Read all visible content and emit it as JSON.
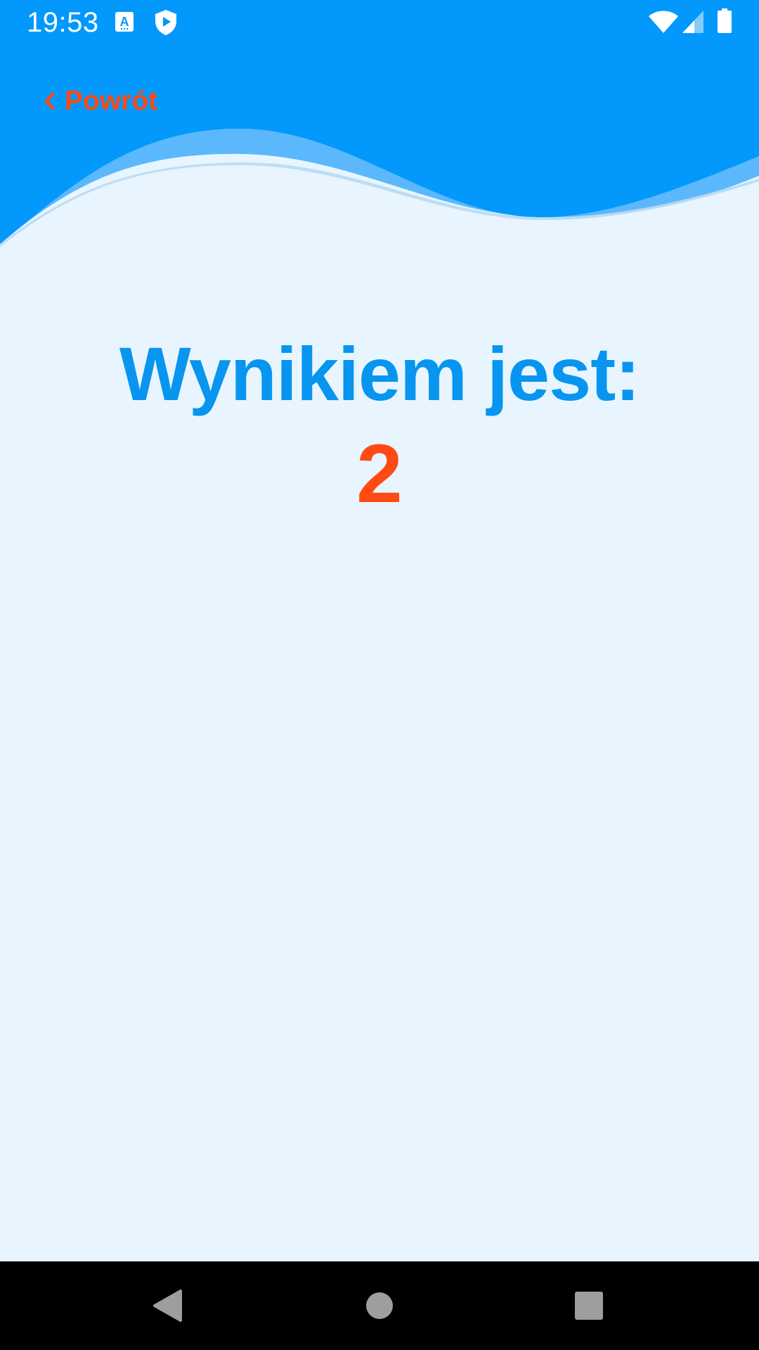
{
  "status_bar": {
    "time": "19:53",
    "icons": [
      "translate-icon",
      "shield-play-icon",
      "wifi-icon",
      "cellular-signal-icon",
      "battery-icon"
    ]
  },
  "header": {
    "back_label": "Powrót",
    "back_icon": "chevron-left-icon"
  },
  "main": {
    "result_title": "Wynikiem jest:",
    "result_value": "2"
  },
  "nav_bar": {
    "buttons": [
      "back-triangle-icon",
      "home-circle-icon",
      "recents-square-icon"
    ]
  },
  "colors": {
    "header_blue": "#0398FB",
    "wave_light_blue": "#5BB8FD",
    "background": "#E8F5FE",
    "title_blue": "#0795EF",
    "accent_orange": "#FF4A13",
    "nav_bar": "#000000"
  }
}
